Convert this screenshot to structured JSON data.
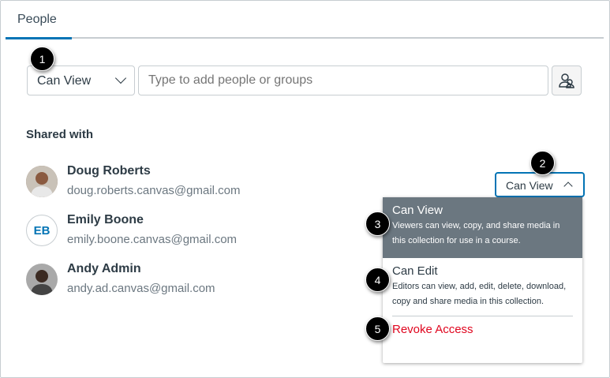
{
  "tabs": [
    {
      "label": "People"
    }
  ],
  "permission_select": {
    "value": "Can View"
  },
  "search": {
    "placeholder": "Type to add people or groups"
  },
  "shared_with": {
    "heading": "Shared with",
    "people": [
      {
        "name": "Doug Roberts",
        "email": "doug.roberts.canvas@gmail.com"
      },
      {
        "name": "Emily Boone",
        "email": "emily.boone.canvas@gmail.com",
        "initials": "EB"
      },
      {
        "name": "Andy Admin",
        "email": "andy.ad.canvas@gmail.com"
      }
    ]
  },
  "role_button": {
    "label": "Can View"
  },
  "menu": {
    "options": [
      {
        "title": "Can View",
        "desc": "Viewers can view, copy, and share media in this collection for use in a course."
      },
      {
        "title": "Can Edit",
        "desc": "Editors can view, add, edit, delete, download, copy and share media in this collection."
      }
    ],
    "revoke": "Revoke Access"
  },
  "callouts": [
    "1",
    "2",
    "3",
    "4",
    "5"
  ],
  "colors": {
    "accent": "#0374b5",
    "danger": "#e0061f",
    "active_bg": "#6b7780"
  }
}
